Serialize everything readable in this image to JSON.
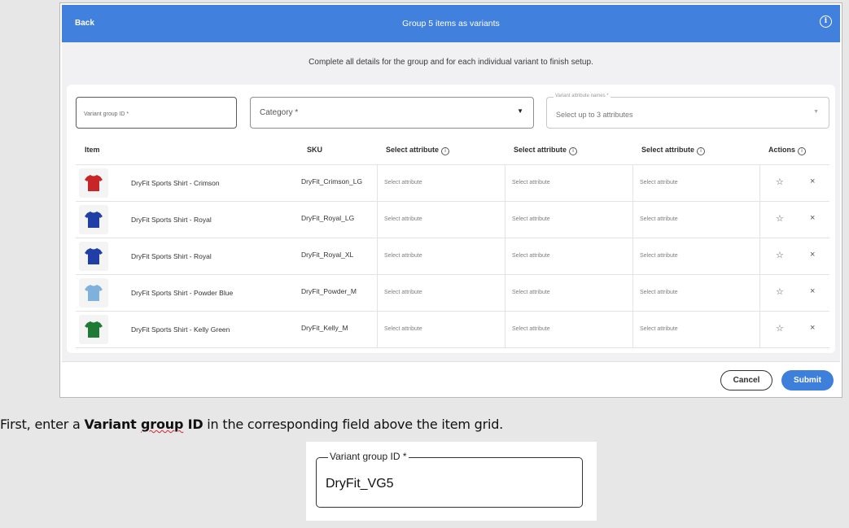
{
  "dialog": {
    "back_label": "Back",
    "title": "Group 5 items as variants",
    "info_icon": "info-icon",
    "subtitle": "Complete all details for the group and for each individual variant to finish setup."
  },
  "form": {
    "variant_group_placeholder": "Variant group ID *",
    "category_placeholder": "Category *",
    "attribute_names_label": "Variant attribute names *",
    "attribute_names_placeholder": "Select up to 3 attributes"
  },
  "grid": {
    "headers": {
      "item": "Item",
      "sku": "SKU",
      "attr1": "Select attribute",
      "attr2": "Select attribute",
      "attr3": "Select attribute",
      "actions": "Actions"
    },
    "rows": [
      {
        "name": "DryFit Sports Shirt - Crimson",
        "sku": "DryFit_Crimson_LG",
        "color": "#c62626",
        "a1": "Select attribute",
        "a2": "Select attribute",
        "a3": "Select attribute"
      },
      {
        "name": "DryFit Sports Shirt - Royal",
        "sku": "DryFit_Royal_LG",
        "color": "#1f3fa6",
        "a1": "Select attribute",
        "a2": "Select attribute",
        "a3": "Select attribute"
      },
      {
        "name": "DryFit Sports Shirt - Royal",
        "sku": "DryFit_Royal_XL",
        "color": "#1f3fa6",
        "a1": "Select attribute",
        "a2": "Select attribute",
        "a3": "Select attribute"
      },
      {
        "name": "DryFit Sports Shirt - Powder Blue",
        "sku": "DryFit_Powder_M",
        "color": "#7fb1dd",
        "a1": "Select attribute",
        "a2": "Select attribute",
        "a3": "Select attribute"
      },
      {
        "name": "DryFit Sports Shirt - Kelly Green",
        "sku": "DryFit_Kelly_M",
        "color": "#1f7a35",
        "a1": "Select attribute",
        "a2": "Select attribute",
        "a3": "Select attribute"
      }
    ],
    "star_glyph": "☆",
    "remove_glyph": "×"
  },
  "footer": {
    "cancel_label": "Cancel",
    "submit_label": "Submit"
  },
  "instruction": {
    "prefix": "First, enter a ",
    "bold1": "Variant ",
    "bold_squiggle": "group",
    "bold2": " ID",
    "suffix": " in the corresponding field above the item grid."
  },
  "zoom": {
    "label": "Variant group ID *",
    "value": "DryFit_VG5"
  },
  "colors": {
    "header_blue": "#4180dc",
    "submit_blue": "#3f7fdc",
    "page_gray": "#e7e7e7"
  }
}
